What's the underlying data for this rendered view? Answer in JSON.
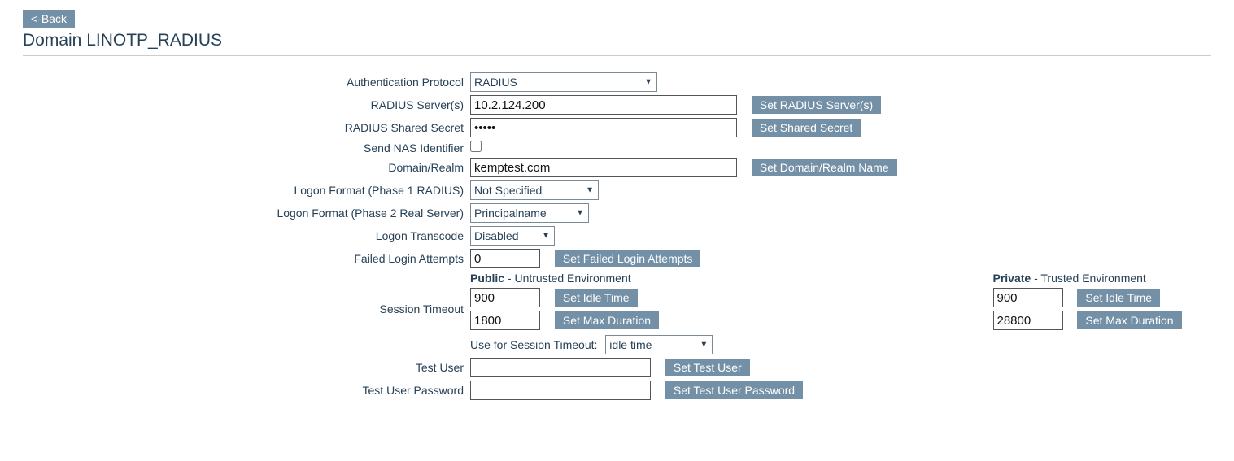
{
  "back_button": "<-Back",
  "page_title": "Domain LINOTP_RADIUS",
  "labels": {
    "auth_protocol": "Authentication Protocol",
    "radius_servers": "RADIUS Server(s)",
    "radius_shared_secret": "RADIUS Shared Secret",
    "send_nas_identifier": "Send NAS Identifier",
    "domain_realm": "Domain/Realm",
    "logon_format_phase1": "Logon Format (Phase 1 RADIUS)",
    "logon_format_phase2": "Logon Format (Phase 2 Real Server)",
    "logon_transcode": "Logon Transcode",
    "failed_login_attempts": "Failed Login Attempts",
    "session_timeout": "Session Timeout",
    "test_user": "Test User",
    "test_user_password": "Test User Password",
    "use_for_session_timeout": "Use for Session Timeout:"
  },
  "values": {
    "auth_protocol": "RADIUS",
    "radius_servers": "10.2.124.200",
    "radius_shared_secret": "•••••",
    "domain_realm": "kemptest.com",
    "logon_format_phase1": "Not Specified",
    "logon_format_phase2": "Principalname",
    "logon_transcode": "Disabled",
    "failed_login_attempts": "0",
    "public_idle": "900",
    "public_max": "1800",
    "private_idle": "900",
    "private_max": "28800",
    "use_for_session_timeout": "idle time",
    "test_user": "",
    "test_user_password": ""
  },
  "buttons": {
    "set_radius_servers": "Set RADIUS Server(s)",
    "set_shared_secret": "Set Shared Secret",
    "set_domain_realm": "Set Domain/Realm Name",
    "set_failed_login": "Set Failed Login Attempts",
    "set_idle_time": "Set Idle Time",
    "set_max_duration": "Set Max Duration",
    "set_test_user": "Set Test User",
    "set_test_user_password": "Set Test User Password"
  },
  "env": {
    "public_bold": "Public",
    "public_rest": " - Untrusted Environment",
    "private_bold": "Private",
    "private_rest": " - Trusted Environment"
  }
}
